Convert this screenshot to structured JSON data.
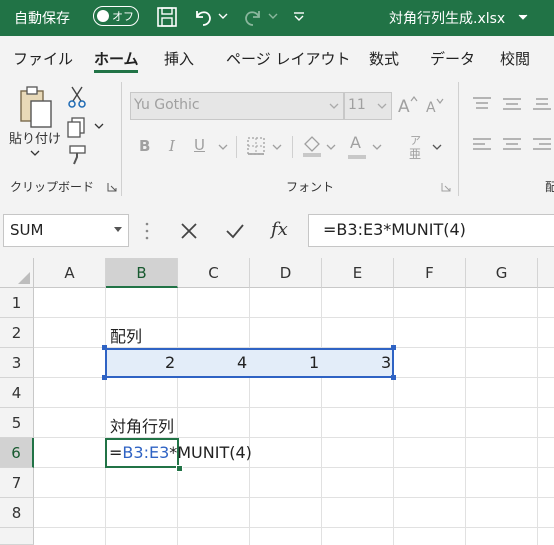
{
  "titlebar": {
    "autosave_label": "自動保存",
    "autosave_state": "オフ",
    "filename": "対角行列生成.xlsx",
    "bg_color": "#217346"
  },
  "tabs": [
    "ファイル",
    "ホーム",
    "挿入",
    "ページ レイアウト",
    "数式",
    "データ",
    "校閲"
  ],
  "active_tab": "ホーム",
  "ribbon": {
    "paste_label": "貼り付け",
    "clipboard_group": "クリップボード",
    "font_group": "フォント",
    "font_name": "Yu Gothic",
    "font_size": "11",
    "bold": "B",
    "italic": "I",
    "underline": "U",
    "font_color_glyph": "A",
    "phonetic_glyph": "ア",
    "phonetic_sub": "亜",
    "cut_partial": "配"
  },
  "formula_bar": {
    "name_box": "SUM",
    "cancel": "✕",
    "enter": "✓",
    "fx": "fx",
    "formula": "=B3:E3*MUNIT(4)"
  },
  "columns": [
    "A",
    "B",
    "C",
    "D",
    "E",
    "F",
    "G"
  ],
  "rows": [
    "1",
    "2",
    "3",
    "4",
    "5",
    "6",
    "7",
    "8"
  ],
  "cells": {
    "B2": "配列",
    "B3": "2",
    "C3": "4",
    "D3": "1",
    "E3": "3",
    "B5": "対角行列",
    "B6_eq": "=",
    "B6_ref": "B3:E3",
    "B6_rest": "*MUNIT(4)"
  },
  "colors": {
    "accent": "#217346",
    "ref_blue": "#2f63c4",
    "ref_fill": "#e3edf9"
  }
}
